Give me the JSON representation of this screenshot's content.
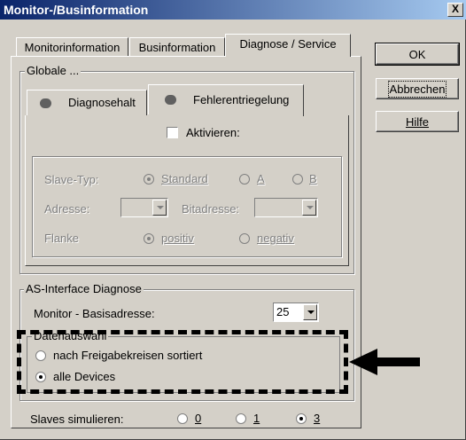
{
  "window": {
    "title": "Monitor-/Businformation",
    "close_glyph": "X"
  },
  "tabs": [
    {
      "label": "Monitorinformation"
    },
    {
      "label": "Businformation"
    },
    {
      "label": "Diagnose / Service"
    }
  ],
  "buttons": {
    "ok": "OK",
    "abbrechen": "Abbrechen",
    "hilfe": "Hilfe"
  },
  "globale": {
    "legend": "Globale ...",
    "subtabs": [
      {
        "label": "Diagnosehalt"
      },
      {
        "label": "Fehlerentriegelung"
      }
    ],
    "aktivieren_label": "Aktivieren:",
    "slave_typ_label": "Slave-Typ:",
    "slave_typ_options": [
      "Standard",
      "A",
      "B"
    ],
    "adresse_label": "Adresse:",
    "bitadresse_label": "Bitadresse:",
    "flanke_label": "Flanke",
    "flanke_options": [
      "positiv",
      "negativ"
    ]
  },
  "asi": {
    "legend": "AS-Interface Diagnose",
    "basisadresse_label": "Monitor - Basisadresse:",
    "basisadresse_value": "25",
    "datenauswahl_legend": "Datenauswahl",
    "option_sortiert": "nach Freigabekreisen sortiert",
    "option_alle": "alle Devices"
  },
  "slaves": {
    "label": "Slaves simulieren:",
    "options": [
      "0",
      "1",
      "3"
    ]
  },
  "colors": {
    "titlebar_start": "#0a246a",
    "face": "#d4d0c8"
  }
}
